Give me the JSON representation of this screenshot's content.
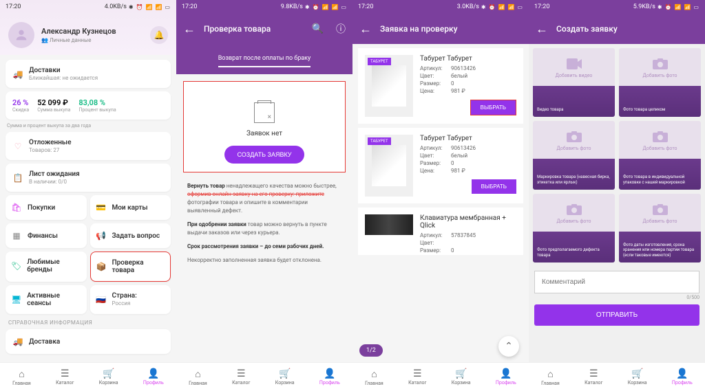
{
  "status": {
    "time": "17:20",
    "speeds": [
      "4.0KB/s",
      "9.8KB/s",
      "3.0KB/s",
      "5.9KB/s"
    ],
    "icons": "✱ ⏰ ⚡ 📶 📶 🔋"
  },
  "s1": {
    "name": "Александр Кузнецов",
    "personal": "Личные данные",
    "delivery": {
      "title": "Доставки",
      "sub": "Ближайшая: не ожидается"
    },
    "stats": {
      "discount": "26 %",
      "discount_l": "Скидка",
      "sum": "52 099 ₽",
      "sum_l": "Сумма выкупа",
      "pct": "83,08 %",
      "pct_l": "Процент выкупа",
      "footer": "Сумма и процент выкупа за два года"
    },
    "deferred": {
      "title": "Отложенные",
      "sub": "Товаров: 27"
    },
    "wishlist": {
      "title": "Лист ожидания",
      "sub": "В наличии: 0/0"
    },
    "items": {
      "purchases": "Покупки",
      "cards": "Мои карты",
      "finance": "Финансы",
      "ask": "Задать вопрос",
      "brands": "Любимые бренды",
      "check": "Проверка товара",
      "sessions": "Активные сеансы",
      "country": "Страна:",
      "country_v": "Россия"
    },
    "ref_section": "СПРАВОЧНАЯ ИНФОРМАЦИЯ",
    "ref_delivery": "Доставка"
  },
  "s2": {
    "title": "Проверка товара",
    "tab": "Возврат после оплаты по браку",
    "empty": "Заявок нет",
    "create_btn": "СОЗДАТЬ ЗАЯВКУ",
    "info1a": "Вернуть товар",
    "info1b": " ненадлежащего качества можно быстрее, ",
    "info1c": "оформив онлайн-заявку на его проверку: приложите",
    "info1d": " фотографии товара и опишите в комментарии выявленный дефект.",
    "info2a": "При одобрении заявки",
    "info2b": " товар можно вернуть в пункте выдачи заказов или через курьера.",
    "info3": "Срок рассмотрения заявки – до семи рабочих дней.",
    "info4": "Некорректно заполненная заявка будет отклонена."
  },
  "s3": {
    "title": "Заявка на проверку",
    "badge": "ТАБУРЕТ",
    "products": [
      {
        "name": "Табурет Табурет",
        "art": "90613426",
        "color": "белый",
        "size": "0",
        "price": "981 ₽"
      },
      {
        "name": "Табурет Табурет",
        "art": "90613426",
        "color": "белый",
        "size": "0",
        "price": "981 ₽"
      },
      {
        "name": "Клавиатура мембранная + Qlick",
        "art": "57837845",
        "color": "",
        "size": "0",
        "price": ""
      }
    ],
    "labels": {
      "art": "Артикул:",
      "color": "Цвет:",
      "size": "Размер:",
      "price": "Цена:"
    },
    "select_btn": "ВЫБРАТЬ",
    "page": "1/2"
  },
  "s4": {
    "title": "Создать заявку",
    "tiles": [
      {
        "top": "Добавить видео",
        "bottom": "Видео товара",
        "type": "video"
      },
      {
        "top": "Добавить фото",
        "bottom": "Фото товара целиком",
        "type": "photo"
      },
      {
        "top": "Добавить фото",
        "bottom": "Маркировка товара (навесная бирка, этикетка или ярлык)",
        "type": "photo"
      },
      {
        "top": "Добавить фото",
        "bottom": "Фото товара в индивидуальной упаковке с нашей маркировкой",
        "type": "photo"
      },
      {
        "top": "Добавить фото",
        "bottom": "Фото предполагаемого дефекта товара",
        "type": "photo"
      },
      {
        "top": "Добавить фото",
        "bottom": "Фото даты изготовления, срока хранения или номера партии товара (если таковые имеются)",
        "type": "photo"
      }
    ],
    "comment_ph": "Комментарий",
    "char_count": "0/500",
    "submit": "ОТПРАВИТЬ"
  },
  "nav": {
    "home": "Главная",
    "catalog": "Каталог",
    "cart": "Корзина",
    "profile": "Профиль"
  }
}
